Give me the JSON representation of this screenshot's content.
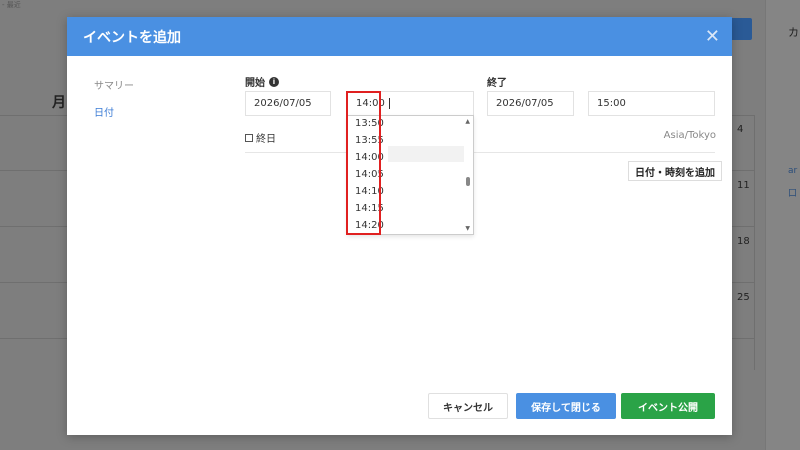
{
  "background": {
    "heading": "月",
    "day_numbers": [
      "4",
      "11",
      "18",
      "25"
    ],
    "right_texts": [
      "カ",
      "ar",
      "口"
    ],
    "top_left_text": "- 最近"
  },
  "modal": {
    "title": "イベントを追加",
    "close_icon": "close-icon",
    "nav": {
      "summary": "サマリー",
      "date": "日付"
    },
    "start_label": "開始",
    "end_label": "終了",
    "start_date": "2026/07/05",
    "start_time": "14:00",
    "end_date": "2026/07/05",
    "end_time": "15:00",
    "all_day_label": "終日",
    "timezone": "Asia/Tokyo",
    "add_date_button": "日付・時刻を追加",
    "time_options": [
      "13:50",
      "13:55",
      "14:00",
      "14:05",
      "14:10",
      "14:15",
      "14:20"
    ],
    "buttons": {
      "cancel": "キャンセル",
      "save_close": "保存して閉じる",
      "publish": "イベント公開"
    },
    "colors": {
      "header": "#4a90e2",
      "save": "#4a90e2",
      "publish": "#2aa347",
      "highlight": "#e02020"
    }
  }
}
